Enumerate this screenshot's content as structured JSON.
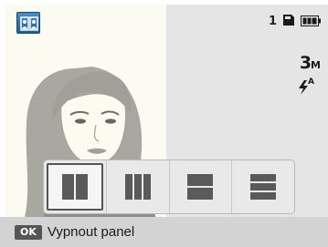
{
  "status_bar": {
    "mode_icon": "panorama-split-mode-icon",
    "shot_count": "1",
    "memory_card_icon": "memory-card-icon",
    "battery_icon": "battery-full-icon"
  },
  "settings": {
    "resolution_main": "3",
    "resolution_unit": "M",
    "flash_icon": "flash-auto-icon",
    "flash_label": "A"
  },
  "split_panel": {
    "options": [
      {
        "icon": "split-two-vertical-icon",
        "selected": true
      },
      {
        "icon": "split-three-vertical-icon",
        "selected": false
      },
      {
        "icon": "split-two-horizontal-icon",
        "selected": false
      },
      {
        "icon": "split-three-horizontal-icon",
        "selected": false
      }
    ]
  },
  "footer": {
    "ok_key": "OK",
    "label": "Vypnout panel"
  },
  "colors": {
    "live_view": "#e5e5e5",
    "photo_background": "#fbfbf2",
    "footer_background": "#d3d3d3",
    "mode_icon_blue": "#2e6fa1"
  }
}
